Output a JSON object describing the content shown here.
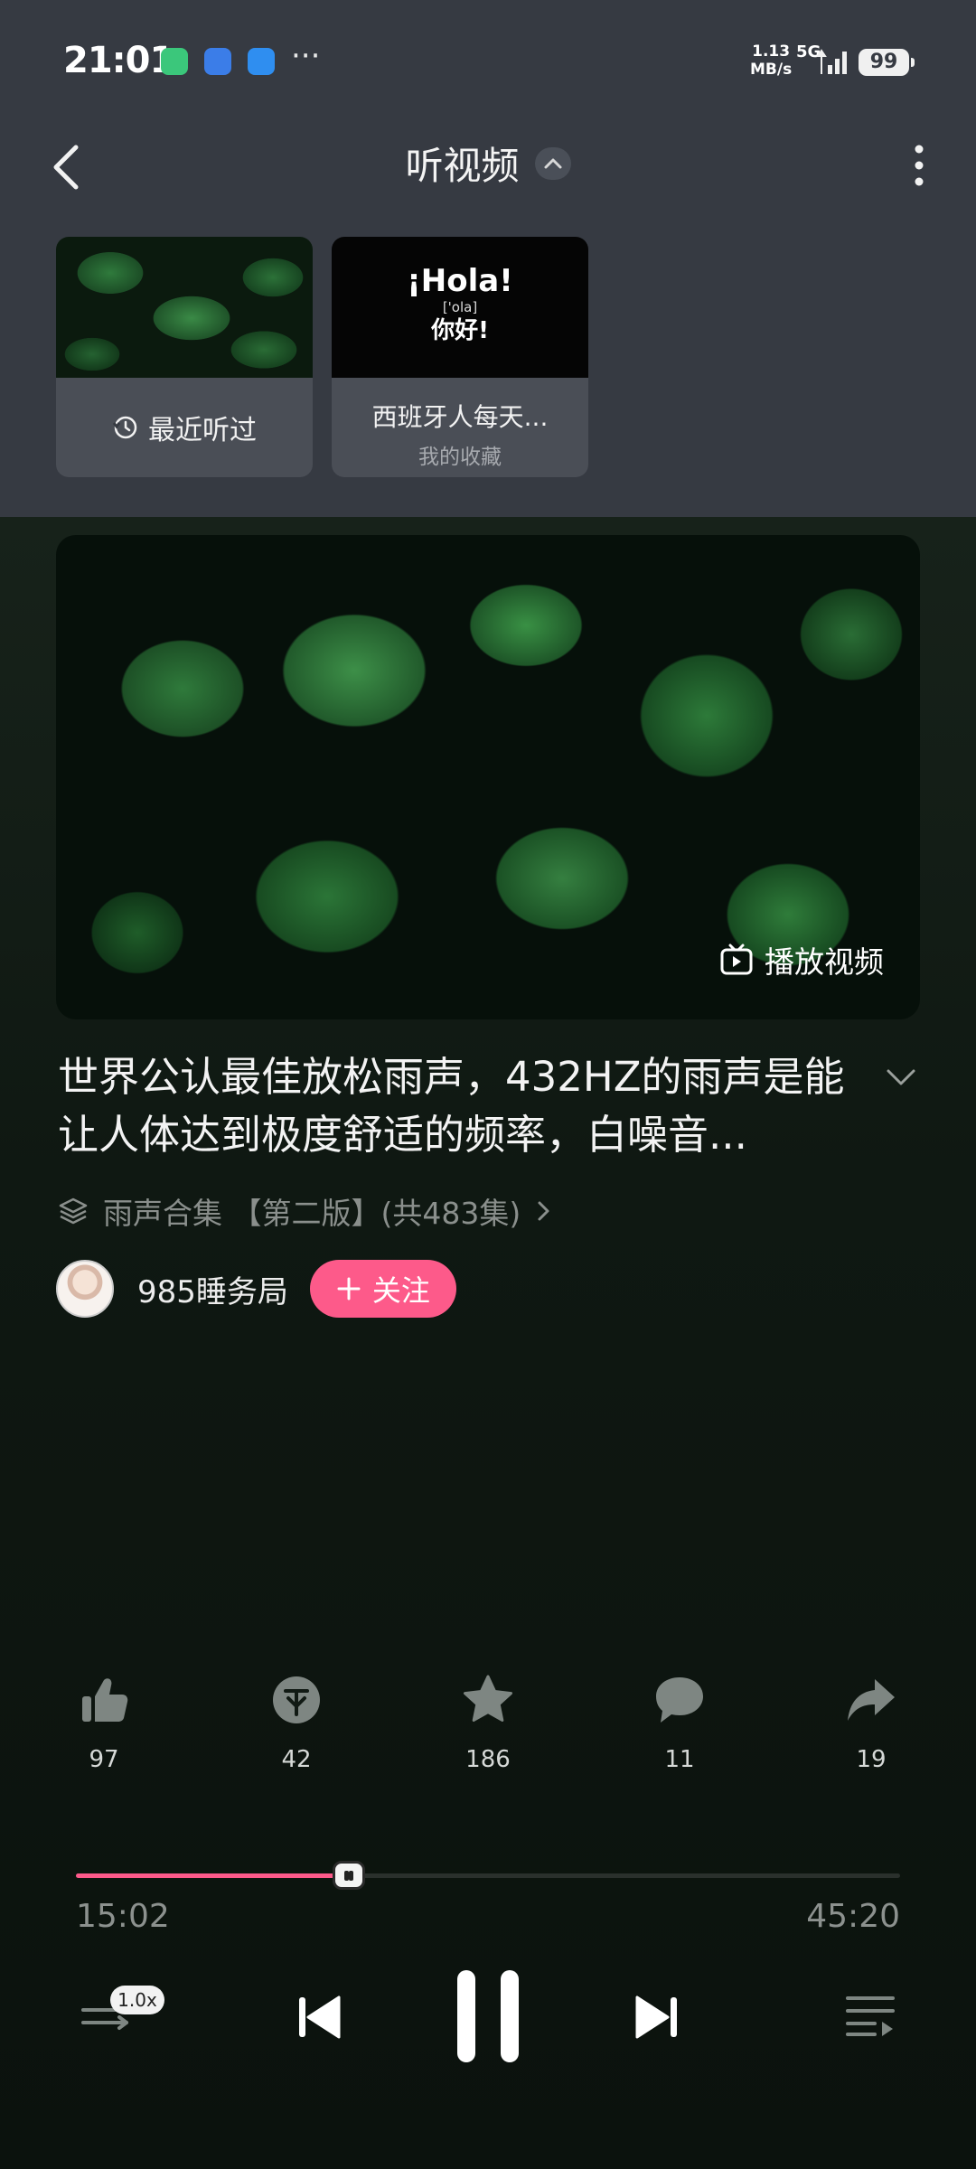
{
  "status_bar": {
    "time": "21:01",
    "more": "···",
    "network_speed_value": "1.13",
    "network_speed_unit": "MB/s",
    "network_type": "5G",
    "battery": "99"
  },
  "header": {
    "title": "听视频"
  },
  "cards": [
    {
      "label": "最近听过"
    },
    {
      "thumb_main": "¡Hola!",
      "thumb_phonetic": "['ola]",
      "thumb_zh": "你好!",
      "title": "西班牙人每天...",
      "subtitle": "我的收藏"
    }
  ],
  "player": {
    "play_video_label": "播放视频",
    "title": "世界公认最佳放松雨声，432HZ的雨声是能让人体达到极度舒适的频率，白噪音...",
    "collection": "雨声合集 【第二版】(共483集)",
    "author": "985睡务局",
    "follow_label": "关注",
    "actions": {
      "like": "97",
      "coin": "42",
      "favorite": "186",
      "comment": "11",
      "share": "19"
    },
    "current_time": "15:02",
    "total_time": "45:20",
    "progress": 0.331,
    "speed": "1.0x"
  },
  "colors": {
    "accent": "#fd5a8a",
    "top_background": "#363a42",
    "main_background": "#0c140f"
  }
}
